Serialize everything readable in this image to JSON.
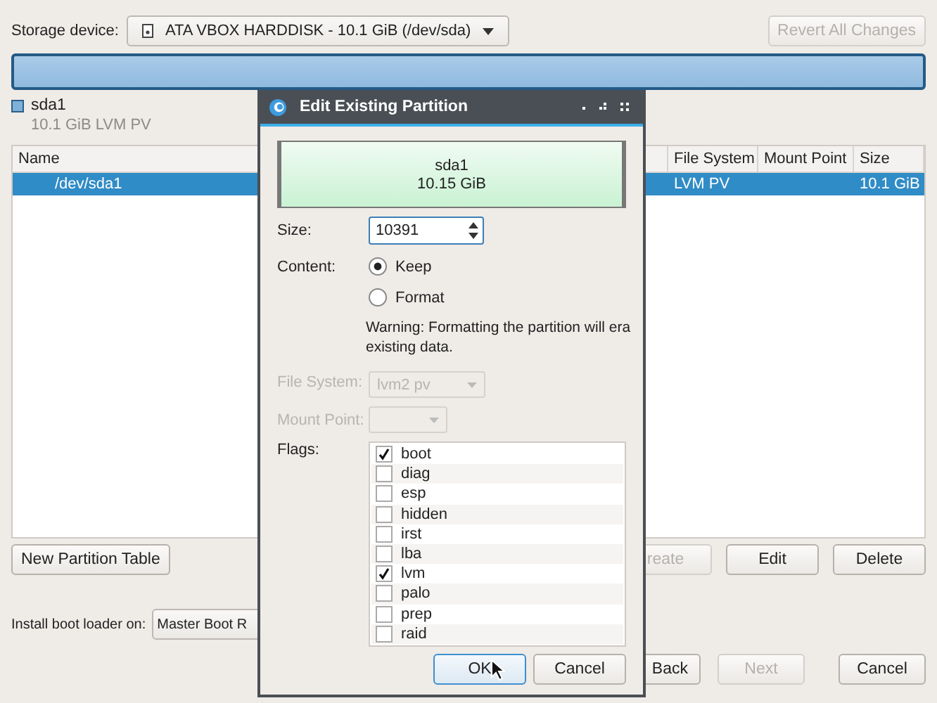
{
  "storage": {
    "label": "Storage device:",
    "device": "ATA VBOX HARDDISK - 10.1 GiB (/dev/sda)"
  },
  "revert_button": {
    "label": "Revert All Changes",
    "disabled": true
  },
  "legend": {
    "name": "sda1",
    "details": "10.1 GiB  LVM PV"
  },
  "table": {
    "columns": [
      "Name",
      "File System",
      "Mount Point",
      "Size"
    ],
    "rows": [
      {
        "name": "/dev/sda1",
        "file_system": "LVM PV",
        "size": "10.1 GiB",
        "selected": true
      }
    ]
  },
  "left_actions": [
    {
      "label": "New Partition Table",
      "disabled": false
    }
  ],
  "right_actions": [
    {
      "label": "reate",
      "disabled": true
    },
    {
      "label": "Edit",
      "disabled": false
    },
    {
      "label": "Delete",
      "disabled": false
    }
  ],
  "boot_loader": {
    "label": "Install boot loader on:",
    "value": "Master Boot R"
  },
  "nav_buttons": [
    {
      "label": "Back",
      "disabled": false
    },
    {
      "label": "Next",
      "disabled": true
    },
    {
      "label": "Cancel",
      "disabled": false
    }
  ],
  "dialog": {
    "title": "Edit Existing Partition",
    "preview": {
      "name": "sda1",
      "size": "10.15 GiB"
    },
    "size_label": "Size:",
    "size_value": "10391",
    "content_label": "Content:",
    "content_options": [
      {
        "label": "Keep",
        "selected": true
      },
      {
        "label": "Format",
        "selected": false
      }
    ],
    "warning": [
      "Warning: Formatting the partition will era",
      "existing data."
    ],
    "file_system": {
      "label": "File System:",
      "value": "lvm2 pv",
      "disabled": true
    },
    "mount_point": {
      "label": "Mount Point:",
      "disabled": true
    },
    "flags_label": "Flags:",
    "flags": [
      {
        "label": "boot",
        "checked": true
      },
      {
        "label": "diag",
        "checked": false
      },
      {
        "label": "esp",
        "checked": false
      },
      {
        "label": "hidden",
        "checked": false
      },
      {
        "label": "irst",
        "checked": false
      },
      {
        "label": "lba",
        "checked": false
      },
      {
        "label": "lvm",
        "checked": true
      },
      {
        "label": "palo",
        "checked": false
      },
      {
        "label": "prep",
        "checked": false
      },
      {
        "label": "raid",
        "checked": false
      }
    ],
    "buttons": [
      "OK",
      "Cancel"
    ]
  }
}
